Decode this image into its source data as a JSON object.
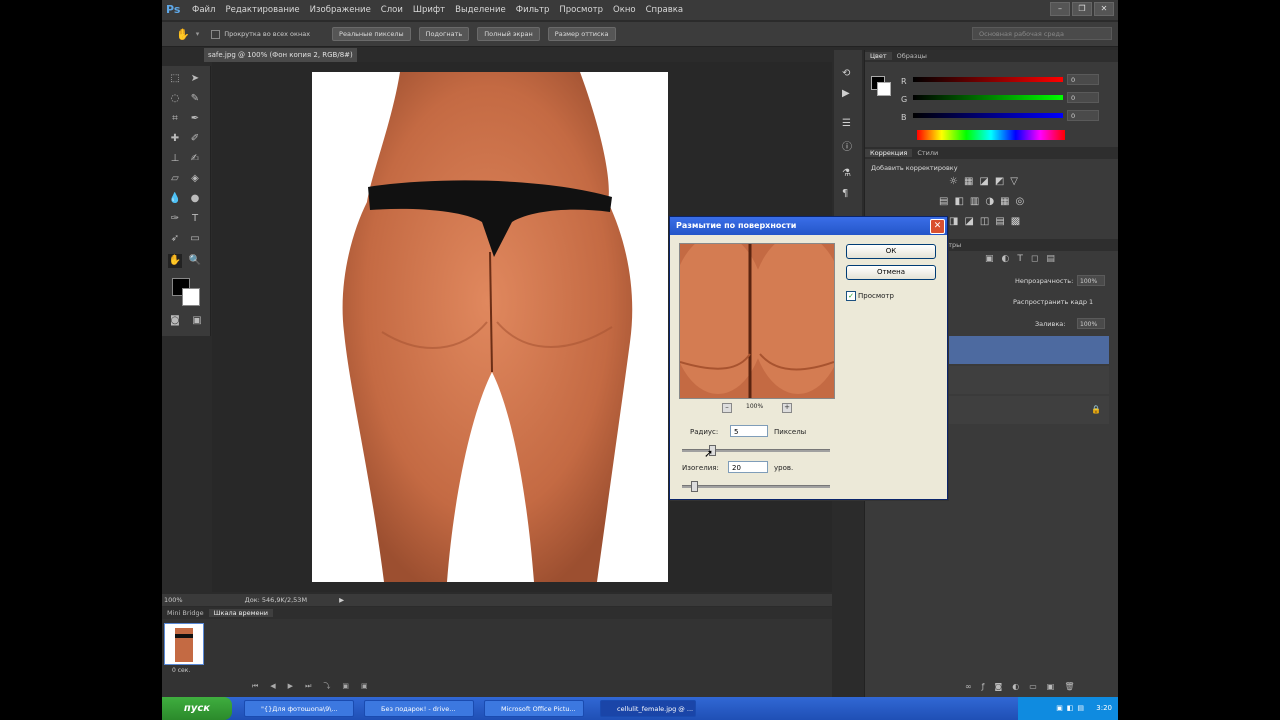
{
  "app": {
    "logo": "Ps"
  },
  "menu": [
    "Файл",
    "Редактирование",
    "Изображение",
    "Слои",
    "Шрифт",
    "Выделение",
    "Фильтр",
    "Просмотр",
    "Окно",
    "Справка"
  ],
  "options_bar": {
    "checkbox_label": "Прокрутка во всех окнах",
    "buttons": [
      "Реальные пикселы",
      "Подогнать",
      "Полный экран",
      "Размер оттиска"
    ],
    "workspace": "Основная рабочая среда"
  },
  "document_tab": {
    "title": "safe.jpg @ 100% (Фон копия 2, RGB/8#)"
  },
  "status": {
    "zoom": "100%",
    "doc_size": "Док: 546,9K/2,53M"
  },
  "bottom_panel": {
    "tabs": [
      "Mini Bridge",
      "Шкала времени"
    ],
    "frame_time": "0 сек."
  },
  "right_panel": {
    "color_tabs": [
      "Цвет",
      "Образцы"
    ],
    "rgb": [
      {
        "label": "R",
        "value": "0"
      },
      {
        "label": "G",
        "value": "0"
      },
      {
        "label": "B",
        "value": "0"
      }
    ],
    "adjust_tabs": [
      "Коррекция",
      "Стили"
    ],
    "adjust_title": "Добавить корректировку",
    "layers": {
      "opacity_label": "Непрозрачность:",
      "opacity_value": "100%",
      "propagate_label": "Распространить кадр 1",
      "fill_label": "Заливка:",
      "fill_value": "100%",
      "tab_partial": "ентры"
    }
  },
  "dialog": {
    "title": "Размытие по поверхности",
    "ok": "ОК",
    "cancel": "Отмена",
    "preview_label": "Просмотр",
    "zoom": "100%",
    "radius_label": "Радиус:",
    "radius_value": "5",
    "radius_unit": "Пикселы",
    "threshold_label": "Изогелия:",
    "threshold_value": "20",
    "threshold_unit": "уров.",
    "radius_fraction": 0.2,
    "threshold_fraction": 0.08
  },
  "taskbar": {
    "start": "пуск",
    "tasks": [
      "\"{}Для фотошопа\\9\\...",
      "Без подарок! - drive...",
      "Microsoft Office Pictu...",
      "cellulit_female.jpg @ ..."
    ],
    "time": "3:20"
  },
  "colors": {
    "ps_bg": "#2b2b2b",
    "dialog_bg": "#ece9d8",
    "xp_blue": "#2456c8"
  }
}
